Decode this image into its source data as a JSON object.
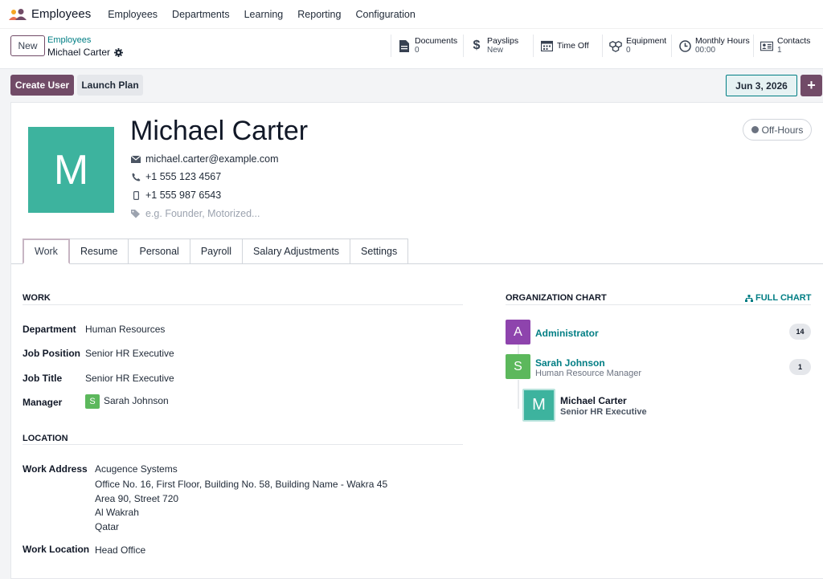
{
  "app": {
    "name": "Employees"
  },
  "menu": [
    "Employees",
    "Departments",
    "Learning",
    "Reporting",
    "Configuration"
  ],
  "control": {
    "new_label": "New",
    "breadcrumb_parent": "Employees",
    "breadcrumb_current": "Michael Carter"
  },
  "stats": [
    {
      "label": "Documents",
      "value": "0",
      "icon": "document-icon"
    },
    {
      "label": "Payslips",
      "value": "New",
      "icon": "dollar-icon"
    },
    {
      "label": "Time Off",
      "value": "",
      "icon": "calendar-icon"
    },
    {
      "label": "Equipment",
      "value": "0",
      "icon": "cubes-icon"
    },
    {
      "label": "Monthly Hours",
      "value": "00:00",
      "icon": "clock-icon"
    },
    {
      "label": "Contacts",
      "value": "1",
      "icon": "contact-card-icon"
    }
  ],
  "actions": {
    "create_user": "Create User",
    "launch_plan": "Launch Plan",
    "date": "Jun 3, 2026",
    "plus": "+"
  },
  "employee": {
    "initial": "M",
    "name": "Michael Carter",
    "email": "michael.carter@example.com",
    "work_phone": "+1 555 123 4567",
    "mobile": "+1 555 987 6543",
    "tags_placeholder": "e.g. Founder, Motorized...",
    "presence": "Off-Hours"
  },
  "tabs": [
    "Work",
    "Resume",
    "Personal",
    "Payroll",
    "Salary Adjustments",
    "Settings"
  ],
  "work": {
    "title": "WORK",
    "department_label": "Department",
    "department": "Human Resources",
    "job_position_label": "Job Position",
    "job_position": "Senior HR Executive",
    "job_title_label": "Job Title",
    "job_title": "Senior HR Executive",
    "manager_label": "Manager",
    "manager_initial": "S",
    "manager": "Sarah Johnson"
  },
  "location": {
    "title": "LOCATION",
    "work_address_label": "Work Address",
    "address_lines": [
      "Acugence Systems",
      "Office No. 16, First Floor, Building No. 58, Building Name - Wakra 45",
      "Area 90, Street 720",
      "Al Wakrah",
      "Qatar"
    ],
    "work_location_label": "Work Location",
    "work_location": "Head Office"
  },
  "org": {
    "title": "ORGANIZATION CHART",
    "full_chart": "FULL CHART",
    "nodes": [
      {
        "initial": "A",
        "name": "Administrator",
        "job": "",
        "count": "14",
        "color": "#8e44ad"
      },
      {
        "initial": "S",
        "name": "Sarah Johnson",
        "job": "Human Resource Manager",
        "count": "1",
        "color": "#5cb85c"
      },
      {
        "initial": "M",
        "name": "Michael Carter",
        "job": "Senior HR Executive",
        "count": "",
        "color": "#3db39e"
      }
    ]
  },
  "colors": {
    "brand": "#714b67",
    "teal": "#017e84",
    "avatar": "#3db39e"
  }
}
